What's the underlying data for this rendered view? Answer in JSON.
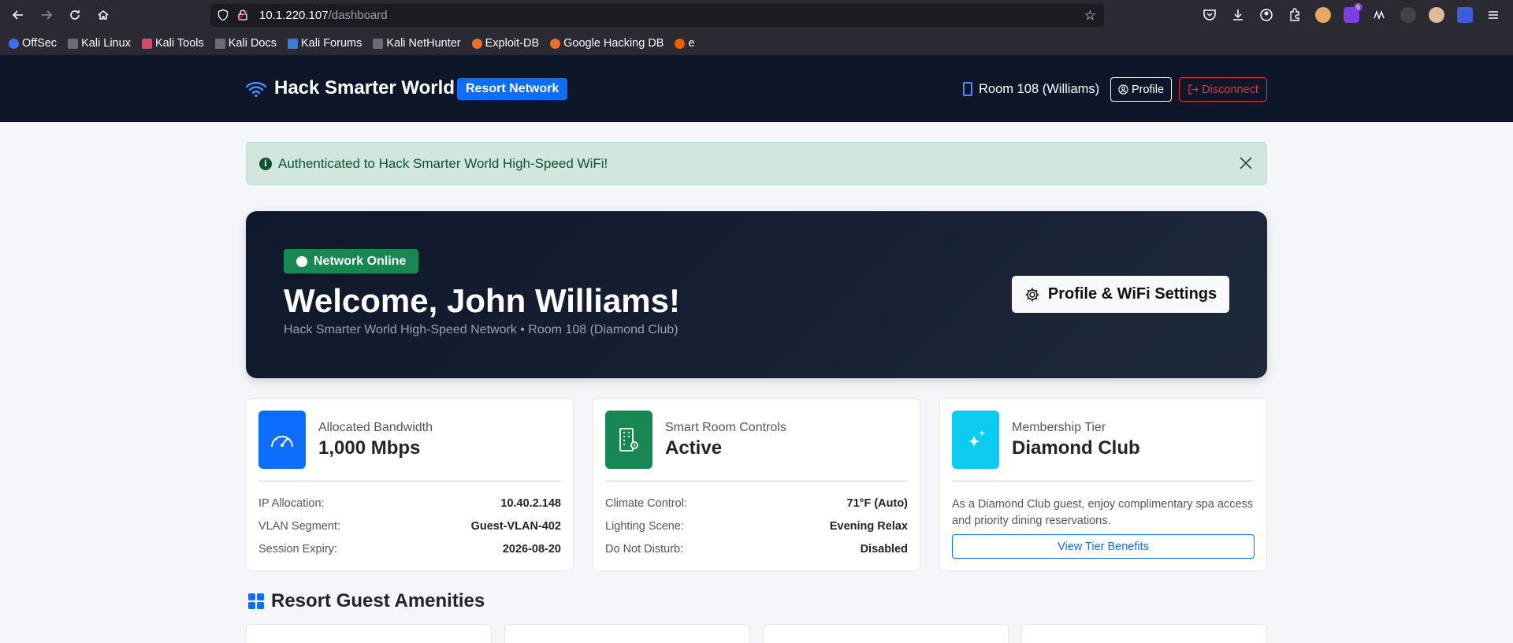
{
  "browser": {
    "url_host": "10.1.220.107",
    "url_path": "/dashboard",
    "bookmarks": [
      "OffSec",
      "Kali Linux",
      "Kali Tools",
      "Kali Docs",
      "Kali Forums",
      "Kali NetHunter",
      "Exploit-DB",
      "Google Hacking DB",
      "e"
    ],
    "extension_badge": "6"
  },
  "navbar": {
    "brand": "Hack Smarter World",
    "badge": "Resort Network",
    "room": "Room 108 (Williams)",
    "profile_label": "Profile",
    "disconnect_label": "Disconnect"
  },
  "alert": {
    "message": "Authenticated to Hack Smarter World High-Speed WiFi!"
  },
  "hero": {
    "status": "Network Online",
    "title": "Welcome, John Williams!",
    "subtitle": "Hack Smarter World High-Speed Network • Room 108 (Diamond Club)",
    "settings_button": "Profile & WiFi Settings"
  },
  "cards": {
    "bandwidth": {
      "label": "Allocated Bandwidth",
      "value": "1,000 Mbps",
      "rows": [
        {
          "key": "IP Allocation:",
          "value": "10.40.2.148"
        },
        {
          "key": "VLAN Segment:",
          "value": "Guest-VLAN-402"
        },
        {
          "key": "Session Expiry:",
          "value": "2026-08-20"
        }
      ]
    },
    "room_controls": {
      "label": "Smart Room Controls",
      "value": "Active",
      "rows": [
        {
          "key": "Climate Control:",
          "value": "71°F (Auto)"
        },
        {
          "key": "Lighting Scene:",
          "value": "Evening Relax"
        },
        {
          "key": "Do Not Disturb:",
          "value": "Disabled"
        }
      ]
    },
    "membership": {
      "label": "Membership Tier",
      "value": "Diamond Club",
      "description": "As a Diamond Club guest, enjoy complimentary spa access and priority dining reservations.",
      "button": "View Tier Benefits"
    }
  },
  "amenities": {
    "title": "Resort Guest Amenities"
  },
  "colors": {
    "navbar_bg": "#0e1729",
    "primary": "#0d6efd",
    "success": "#198754",
    "info": "#0dcaf0",
    "danger": "#dc3545"
  }
}
